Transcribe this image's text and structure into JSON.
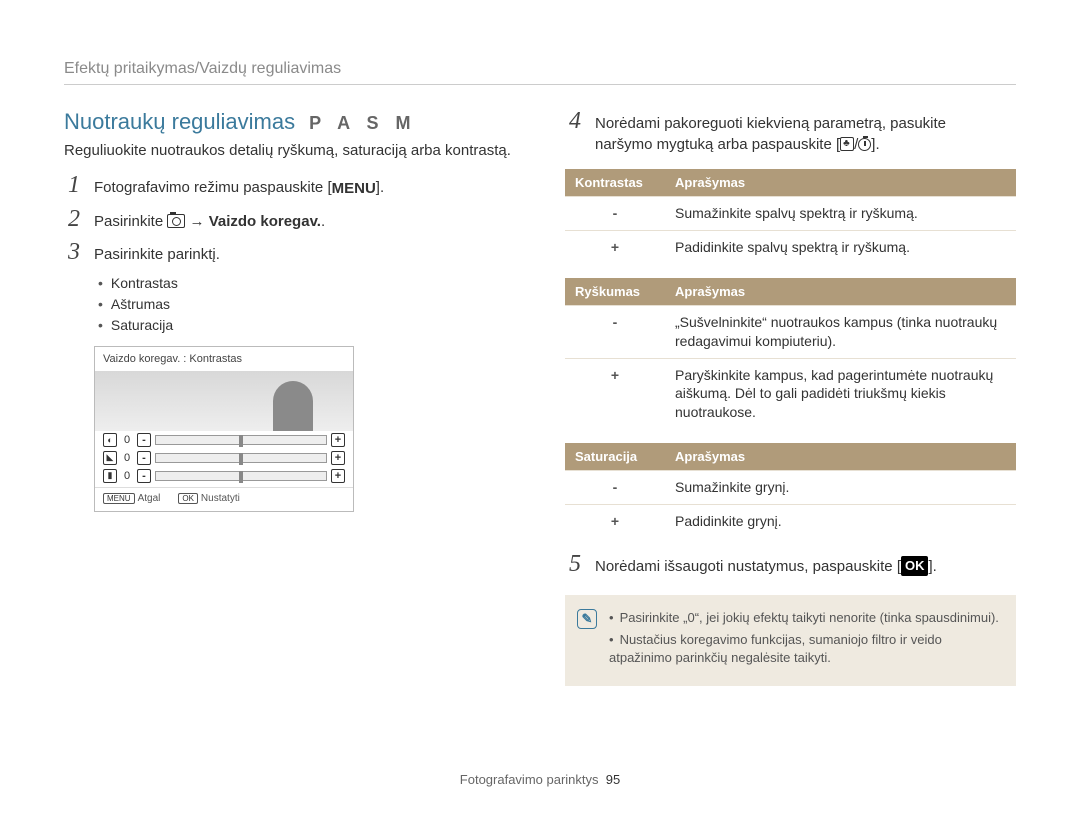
{
  "header": "Efektų pritaikymas/Vaizdų reguliavimas",
  "title": "Nuotraukų reguliavimas",
  "modes": "P A S M",
  "intro": "Reguliuokite nuotraukos detalių ryškumą, saturaciją arba kontrastą.",
  "steps": {
    "s1_pre": "Fotografavimo režimu paspauskite [",
    "s1_menu": "MENU",
    "s1_post": "].",
    "s2_pre": "Pasirinkite ",
    "s2_bold": " → Vaizdo koregav.",
    "s2_post": ".",
    "s3": "Pasirinkite parinktį.",
    "s4_line1": "Norėdami pakoreguoti kiekvieną parametrą, pasukite",
    "s4_line2_pre": "naršymo mygtuką arba paspauskite [",
    "s4_line2_post": "].",
    "s5_pre": "Norėdami išsaugoti nustatymus, paspauskite [",
    "s5_post": "]."
  },
  "bullets": [
    "Kontrastas",
    "Aštrumas",
    "Saturacija"
  ],
  "panel": {
    "title": "Vaizdo koregav. : Kontrastas",
    "val": "0",
    "back_btn": "MENU",
    "back": "Atgal",
    "reset_btn": "OK",
    "reset": "Nustatyti"
  },
  "table1": {
    "h1": "Kontrastas",
    "h2": "Aprašymas",
    "r1k": "-",
    "r1v": "Sumažinkite spalvų spektrą ir ryškumą.",
    "r2k": "+",
    "r2v": "Padidinkite spalvų spektrą ir ryškumą."
  },
  "table2": {
    "h1": "Ryškumas",
    "h2": "Aprašymas",
    "r1k": "-",
    "r1v": "„Sušvelninkite“ nuotraukos kampus (tinka nuotraukų redagavimui kompiuteriu).",
    "r2k": "+",
    "r2v": "Paryškinkite kampus, kad pagerintumėte nuotraukų aiškumą. Dėl to gali padidėti triukšmų kiekis nuotraukose."
  },
  "table3": {
    "h1": "Saturacija",
    "h2": "Aprašymas",
    "r1k": "-",
    "r1v": "Sumažinkite grynį.",
    "r2k": "+",
    "r2v": "Padidinkite grynį."
  },
  "ok": "OK",
  "notes": [
    "Pasirinkite „0“, jei jokių efektų taikyti nenorite (tinka spausdinimui).",
    "Nustačius koregavimo funkcijas, sumaniojo filtro ir veido atpažinimo parinkčių negalėsite taikyti."
  ],
  "footer_text": "Fotografavimo parinktys",
  "page_no": "95"
}
